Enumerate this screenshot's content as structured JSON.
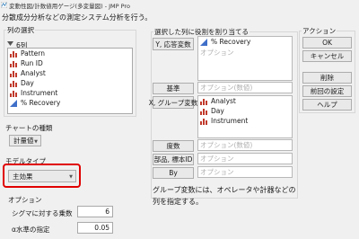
{
  "window": {
    "title": "変動性図/計数値用ゲージ(多変量図) - JMP Pro",
    "icon": "jmp-app-icon"
  },
  "intro_text": "分散成分分析などの測定システム分析を行う。",
  "column_select": {
    "title": "列の選択",
    "count_label": "6列",
    "items": [
      {
        "label": "Pattern",
        "icon": "nominal-icon"
      },
      {
        "label": "Run ID",
        "icon": "nominal-icon"
      },
      {
        "label": "Analyst",
        "icon": "nominal-icon"
      },
      {
        "label": "Day",
        "icon": "nominal-icon"
      },
      {
        "label": "Instrument",
        "icon": "nominal-icon"
      },
      {
        "label": "% Recovery",
        "icon": "continuous-icon"
      }
    ]
  },
  "chart_type": {
    "title": "チャートの種類",
    "value": "計量値"
  },
  "model_type": {
    "title": "モデルタイプ",
    "value": "主効果"
  },
  "options": {
    "title": "オプション",
    "sigma_label": "シグマに対する乗数",
    "sigma_value": "6",
    "alpha_label": "α水準の指定",
    "alpha_value": "0.05"
  },
  "roles": {
    "title": "選択した列に役割を割り当てる",
    "y_button": "Y, 応答変数",
    "y_items": [
      {
        "label": "% Recovery",
        "icon": "continuous-icon"
      }
    ],
    "y_placeholder": "オプション",
    "standard_button": "基準",
    "standard_placeholder": "オプション(数値)",
    "xgroup_button": "X, グループ変数",
    "xgroup_items": [
      {
        "label": "Analyst",
        "icon": "nominal-icon"
      },
      {
        "label": "Day",
        "icon": "nominal-icon"
      },
      {
        "label": "Instrument",
        "icon": "nominal-icon"
      }
    ],
    "freq_button": "度数",
    "freq_placeholder": "オプション(数値)",
    "part_button": "部品, 標本ID",
    "part_placeholder": "オプション",
    "by_button": "By",
    "by_placeholder": "オプション",
    "note": "グループ変数には、オペレータや計器などの列を指定する。"
  },
  "actions": {
    "title": "アクション",
    "ok": "OK",
    "cancel": "キャンセル",
    "remove": "削除",
    "recall": "前回の設定",
    "help": "ヘルプ"
  },
  "colors": {
    "nominal": "#c0392b",
    "continuous": "#3f6fc8",
    "highlight": "#e00000"
  }
}
